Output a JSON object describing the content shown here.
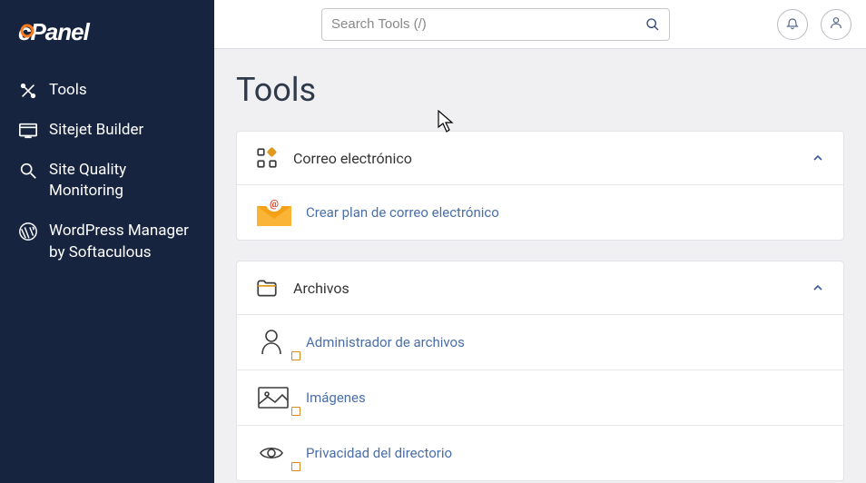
{
  "sidebar": {
    "items": [
      {
        "label": "Tools"
      },
      {
        "label": "Sitejet Builder"
      },
      {
        "label": "Site Quality Monitoring"
      },
      {
        "label": "WordPress Manager by Softaculous"
      }
    ]
  },
  "search": {
    "placeholder": "Search Tools (/)"
  },
  "page": {
    "title": "Tools"
  },
  "sections": [
    {
      "title": "Correo electrónico",
      "items": [
        {
          "label": "Crear plan de correo electrónico"
        }
      ]
    },
    {
      "title": "Archivos",
      "items": [
        {
          "label": "Administrador de archivos"
        },
        {
          "label": "Imágenes"
        },
        {
          "label": "Privacidad del directorio"
        }
      ]
    }
  ]
}
